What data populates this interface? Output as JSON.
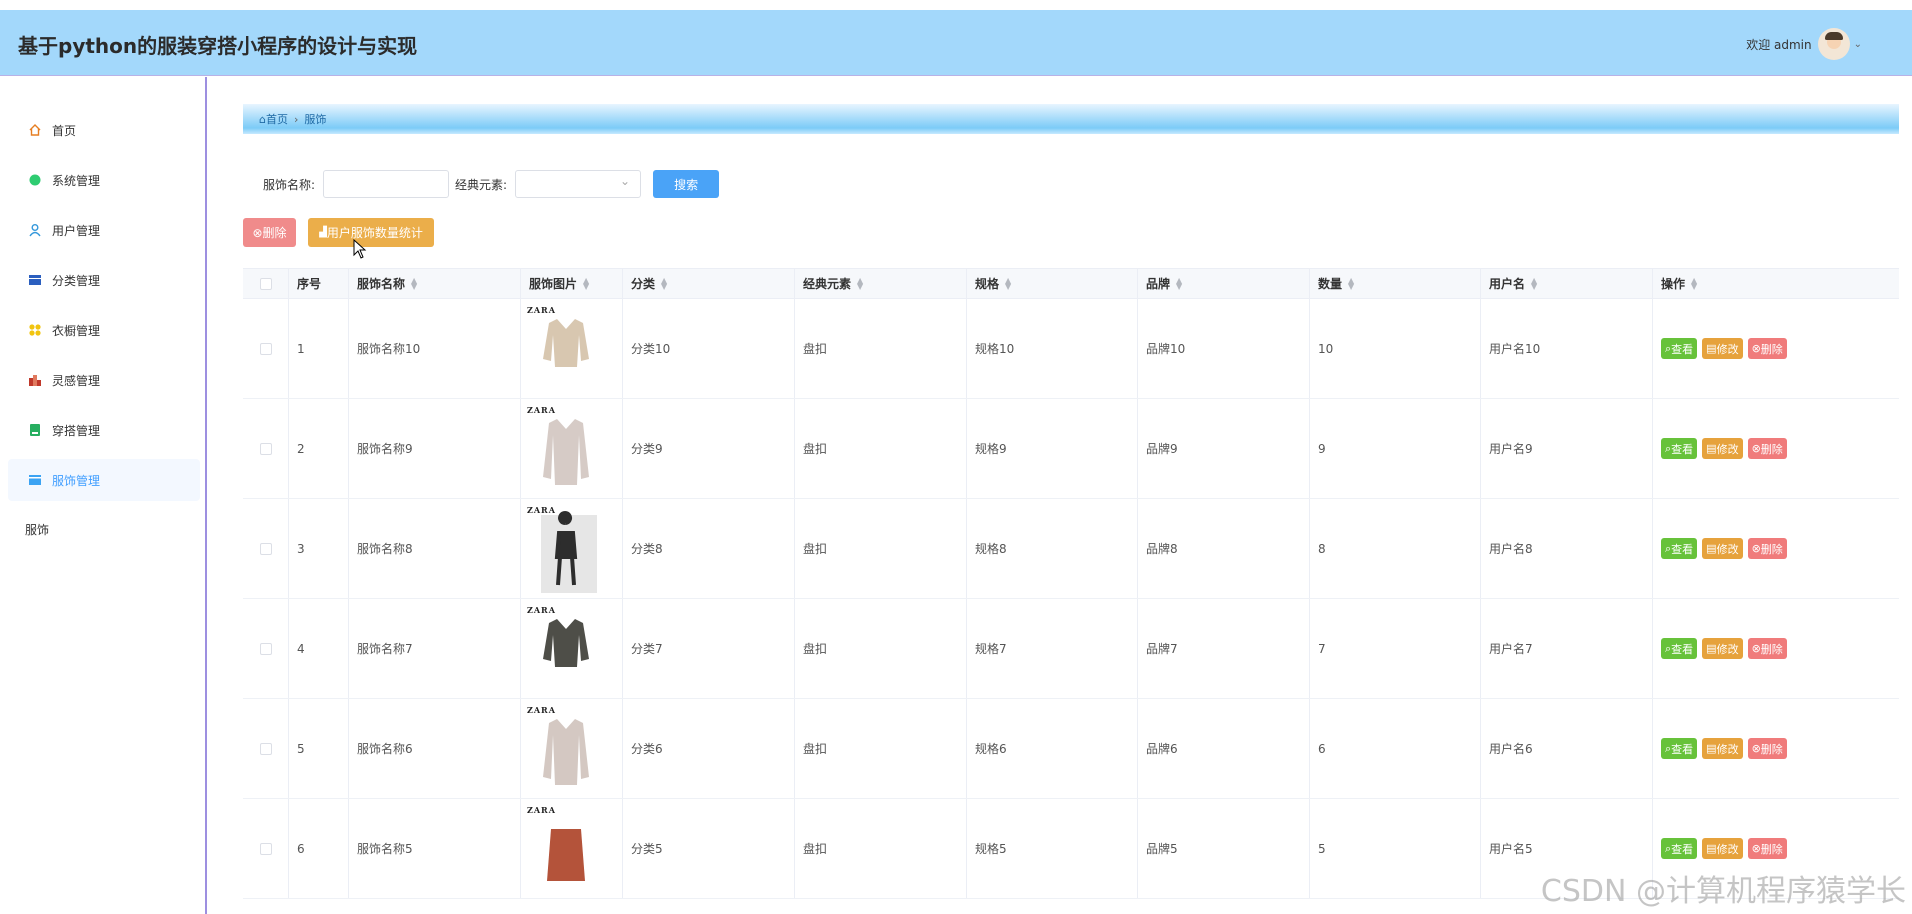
{
  "header": {
    "title": "基于python的服装穿搭小程序的设计与实现",
    "welcome": "欢迎 admin"
  },
  "sidebar": {
    "items": [
      {
        "label": "首页",
        "icon": "home-icon",
        "color": "#e67e22"
      },
      {
        "label": "系统管理",
        "icon": "circle-icon",
        "color": "#2ecc71"
      },
      {
        "label": "用户管理",
        "icon": "user-icon",
        "color": "#3498db"
      },
      {
        "label": "分类管理",
        "icon": "category-icon",
        "color": "#2b5fbf"
      },
      {
        "label": "衣橱管理",
        "icon": "wardrobe-icon",
        "color": "#f1c40f"
      },
      {
        "label": "灵感管理",
        "icon": "inspiration-icon",
        "color": "#c0392b"
      },
      {
        "label": "穿搭管理",
        "icon": "outfit-icon",
        "color": "#27ae60"
      },
      {
        "label": "服饰管理",
        "icon": "clothing-icon",
        "color": "#3ba3f3"
      }
    ],
    "active_sub": "服饰"
  },
  "breadcrumb": {
    "home": "首页",
    "current": "服饰"
  },
  "search": {
    "name_label": "服饰名称:",
    "name_value": "",
    "element_label": "经典元素:",
    "element_value": "",
    "button": "搜索"
  },
  "actions": {
    "delete": "删除",
    "stats": "用户服饰数量统计"
  },
  "table": {
    "headers": [
      "序号",
      "服饰名称",
      "服饰图片",
      "分类",
      "经典元素",
      "规格",
      "品牌",
      "数量",
      "用户名",
      "操作"
    ],
    "rows": [
      {
        "no": "1",
        "name": "服饰名称10",
        "cat": "分类10",
        "element": "盘扣",
        "spec": "规格10",
        "brand": "品牌10",
        "qty": "10",
        "user": "用户名10"
      },
      {
        "no": "2",
        "name": "服饰名称9",
        "cat": "分类9",
        "element": "盘扣",
        "spec": "规格9",
        "brand": "品牌9",
        "qty": "9",
        "user": "用户名9"
      },
      {
        "no": "3",
        "name": "服饰名称8",
        "cat": "分类8",
        "element": "盘扣",
        "spec": "规格8",
        "brand": "品牌8",
        "qty": "8",
        "user": "用户名8"
      },
      {
        "no": "4",
        "name": "服饰名称7",
        "cat": "分类7",
        "element": "盘扣",
        "spec": "规格7",
        "brand": "品牌7",
        "qty": "7",
        "user": "用户名7"
      },
      {
        "no": "5",
        "name": "服饰名称6",
        "cat": "分类6",
        "element": "盘扣",
        "spec": "规格6",
        "brand": "品牌6",
        "qty": "6",
        "user": "用户名6"
      },
      {
        "no": "6",
        "name": "服饰名称5",
        "cat": "分类5",
        "element": "盘扣",
        "spec": "规格5",
        "brand": "品牌5",
        "qty": "5",
        "user": "用户名5"
      }
    ],
    "image_brand": "ZARA",
    "op_view": "查看",
    "op_edit": "修改",
    "op_delete": "删除"
  },
  "watermark": "CSDN @计算机程序猿学长"
}
